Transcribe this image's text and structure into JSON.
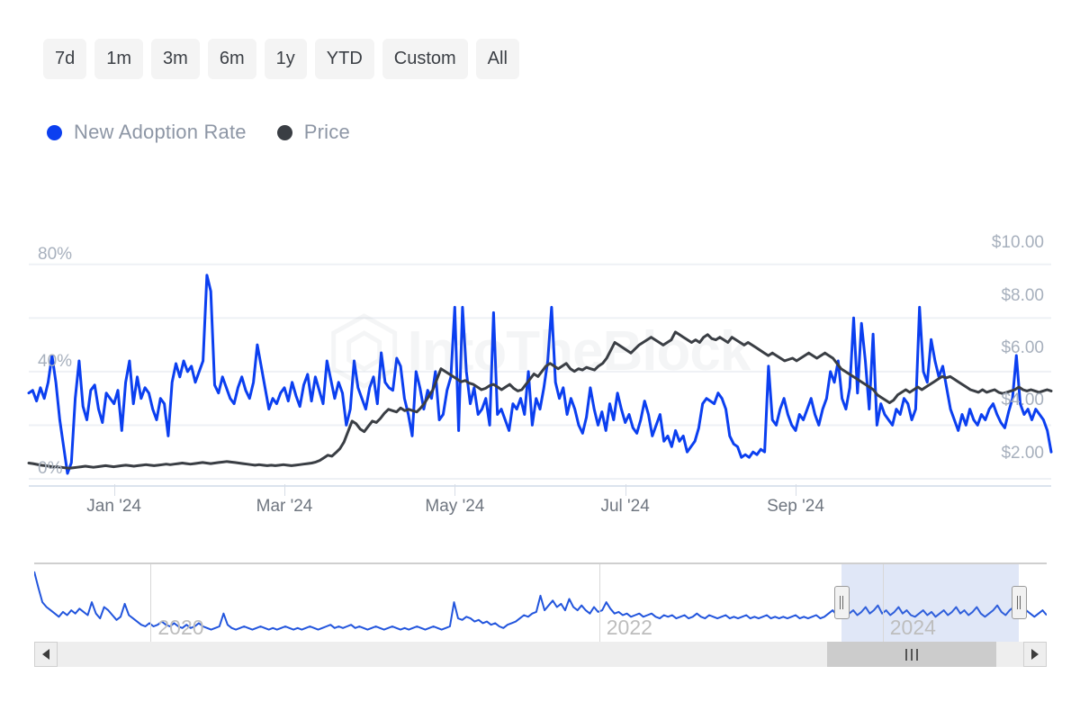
{
  "toolbar": {
    "ranges": [
      {
        "label": "7d",
        "active": false
      },
      {
        "label": "1m",
        "active": false
      },
      {
        "label": "3m",
        "active": false
      },
      {
        "label": "6m",
        "active": false
      },
      {
        "label": "1y",
        "active": false
      },
      {
        "label": "YTD",
        "active": false
      },
      {
        "label": "Custom",
        "active": false
      },
      {
        "label": "All",
        "active": false
      }
    ]
  },
  "legend": [
    {
      "label": "New Adoption Rate",
      "color": "#0b3ff0"
    },
    {
      "label": "Price",
      "color": "#3a3e44"
    }
  ],
  "watermark": {
    "text": "IntoTheBlock",
    "logo": "hexagon-logo-icon"
  },
  "navigator": {
    "years": [
      "2020",
      "2022",
      "2024"
    ],
    "selection_start_label": "left-handle",
    "selection_end_label": "right-handle",
    "scroll_left_label": "scroll-left",
    "scroll_right_label": "scroll-right"
  },
  "colors": {
    "adoption": "#0b3ff0",
    "price": "#3a3e44",
    "grid": "#eef1f5",
    "axis_text": "#a7b0bd",
    "xaxis_text": "#6f7680",
    "nav_select": "rgba(100,135,215,0.20)"
  },
  "chart_data": {
    "type": "line",
    "title": "",
    "xlabel": "",
    "grid": true,
    "legend_position": "top-left",
    "x_tick_labels": [
      "Jan '24",
      "Mar '24",
      "May '24",
      "Jul '24",
      "Sep '24"
    ],
    "x_tick_positions": [
      0.0833,
      0.25,
      0.4167,
      0.5833,
      0.75
    ],
    "axes": {
      "left": {
        "label": "New Adoption Rate",
        "ylabel": "%",
        "ticks": [
          "0%",
          "40%",
          "80%"
        ],
        "tick_values": [
          0,
          40,
          80
        ],
        "ylim": [
          0,
          90
        ],
        "gridline_values": [
          0,
          20,
          40,
          60,
          80
        ]
      },
      "right": {
        "label": "Price",
        "ylabel": "USD",
        "ticks": [
          "$2.00",
          "$4.00",
          "$6.00",
          "$8.00",
          "$10.00"
        ],
        "tick_values": [
          2,
          4,
          6,
          8,
          10
        ],
        "ylim": [
          1.4,
          10.6
        ]
      }
    },
    "series": [
      {
        "name": "New Adoption Rate",
        "color": "#0b3ff0",
        "axis": "left",
        "unit": "%",
        "values": [
          32,
          33,
          29,
          34,
          30,
          36,
          46,
          36,
          22,
          12,
          2,
          6,
          30,
          44,
          27,
          22,
          33,
          35,
          26,
          21,
          32,
          30,
          28,
          33,
          18,
          36,
          44,
          28,
          38,
          30,
          34,
          32,
          26,
          22,
          30,
          28,
          16,
          36,
          43,
          38,
          44,
          40,
          42,
          36,
          40,
          44,
          76,
          70,
          35,
          32,
          38,
          34,
          30,
          28,
          34,
          38,
          33,
          30,
          36,
          50,
          42,
          34,
          26,
          30,
          28,
          32,
          34,
          29,
          36,
          31,
          27,
          35,
          39,
          29,
          38,
          33,
          28,
          44,
          37,
          30,
          36,
          32,
          20,
          26,
          44,
          34,
          30,
          26,
          34,
          38,
          28,
          47,
          36,
          34,
          33,
          45,
          42,
          30,
          24,
          16,
          40,
          34,
          26,
          33,
          30,
          40,
          22,
          24,
          33,
          38,
          64,
          18,
          64,
          40,
          28,
          34,
          24,
          26,
          30,
          20,
          62,
          24,
          26,
          22,
          18,
          28,
          26,
          30,
          24,
          40,
          20,
          30,
          26,
          34,
          44,
          64,
          36,
          30,
          34,
          24,
          30,
          26,
          20,
          17,
          23,
          34,
          26,
          20,
          25,
          18,
          28,
          22,
          32,
          26,
          21,
          24,
          19,
          17,
          22,
          29,
          24,
          16,
          20,
          24,
          14,
          16,
          12,
          18,
          14,
          16,
          10,
          12,
          14,
          19,
          28,
          30,
          29,
          28,
          32,
          30,
          26,
          16,
          13,
          12,
          8,
          9,
          8,
          10,
          9,
          11,
          10,
          42,
          22,
          20,
          26,
          30,
          24,
          20,
          18,
          24,
          22,
          26,
          30,
          24,
          20,
          26,
          30,
          40,
          36,
          44,
          30,
          26,
          34,
          60,
          32,
          58,
          44,
          26,
          54,
          20,
          28,
          24,
          22,
          20,
          26,
          24,
          30,
          28,
          22,
          26,
          64,
          40,
          36,
          52,
          44,
          38,
          42,
          34,
          26,
          22,
          18,
          24,
          20,
          26,
          22,
          20,
          24,
          22,
          26,
          28,
          24,
          21,
          19,
          25,
          30,
          46,
          28,
          24,
          26,
          22,
          26,
          24,
          22,
          18,
          10
        ]
      },
      {
        "name": "Price",
        "color": "#3a3e44",
        "axis": "right",
        "unit": "USD",
        "values": [
          2.0,
          1.98,
          1.95,
          1.92,
          1.9,
          1.88,
          1.85,
          1.86,
          1.84,
          1.82,
          1.8,
          1.82,
          1.84,
          1.86,
          1.88,
          1.86,
          1.84,
          1.86,
          1.88,
          1.9,
          1.88,
          1.86,
          1.88,
          1.9,
          1.92,
          1.9,
          1.88,
          1.9,
          1.92,
          1.94,
          1.92,
          1.9,
          1.92,
          1.94,
          1.96,
          1.94,
          1.96,
          1.98,
          2.0,
          1.98,
          1.96,
          1.98,
          2.0,
          2.02,
          2.0,
          1.98,
          2.0,
          2.02,
          2.04,
          2.06,
          2.04,
          2.02,
          2.0,
          1.98,
          1.96,
          1.94,
          1.92,
          1.94,
          1.92,
          1.9,
          1.92,
          1.9,
          1.92,
          1.94,
          1.92,
          1.9,
          1.92,
          1.94,
          1.96,
          1.98,
          2.0,
          2.04,
          2.1,
          2.2,
          2.3,
          2.26,
          2.4,
          2.55,
          2.8,
          3.2,
          3.6,
          3.5,
          3.3,
          3.2,
          3.4,
          3.6,
          3.55,
          3.7,
          3.9,
          4.05,
          4.0,
          3.95,
          4.1,
          4.0,
          4.05,
          4.0,
          3.95,
          4.1,
          4.3,
          4.55,
          4.8,
          5.2,
          5.6,
          5.5,
          5.4,
          5.3,
          5.2,
          5.1,
          5.15,
          5.05,
          5.0,
          4.9,
          4.8,
          4.85,
          4.95,
          5.0,
          4.9,
          4.8,
          4.9,
          5.0,
          4.85,
          4.75,
          4.8,
          5.0,
          5.2,
          5.4,
          5.3,
          5.5,
          5.7,
          5.8,
          5.7,
          5.6,
          5.7,
          5.8,
          5.6,
          5.5,
          5.6,
          5.55,
          5.65,
          5.6,
          5.55,
          5.7,
          5.8,
          6.0,
          6.3,
          6.6,
          6.5,
          6.4,
          6.3,
          6.2,
          6.35,
          6.5,
          6.6,
          6.7,
          6.8,
          6.7,
          6.6,
          6.5,
          6.6,
          6.7,
          7.0,
          6.9,
          6.8,
          6.7,
          6.6,
          6.7,
          6.6,
          6.8,
          6.9,
          6.75,
          6.7,
          6.8,
          6.7,
          6.6,
          6.8,
          6.7,
          6.6,
          6.5,
          6.6,
          6.5,
          6.4,
          6.3,
          6.2,
          6.1,
          6.2,
          6.1,
          6.0,
          5.9,
          5.95,
          6.0,
          5.9,
          6.0,
          6.1,
          6.2,
          6.1,
          6.0,
          6.1,
          6.2,
          6.1,
          6.0,
          5.8,
          5.6,
          5.5,
          5.4,
          5.3,
          5.2,
          5.1,
          5.0,
          4.9,
          4.8,
          4.6,
          4.5,
          4.4,
          4.3,
          4.4,
          4.6,
          4.7,
          4.8,
          4.7,
          4.8,
          4.9,
          4.8,
          4.9,
          5.0,
          5.1,
          5.2,
          5.3,
          5.25,
          5.3,
          5.2,
          5.1,
          5.0,
          4.9,
          4.8,
          4.75,
          4.7,
          4.8,
          4.7,
          4.75,
          4.8,
          4.7,
          4.65,
          4.7,
          4.75,
          4.8,
          4.9,
          4.8,
          4.75,
          4.8,
          4.75,
          4.7,
          4.75,
          4.8,
          4.75
        ]
      }
    ],
    "navigator_series": {
      "name": "New Adoption Rate (full history)",
      "color": "#2255dd",
      "values": [
        78,
        58,
        40,
        34,
        30,
        26,
        22,
        28,
        24,
        30,
        26,
        32,
        28,
        24,
        40,
        26,
        20,
        34,
        30,
        24,
        18,
        22,
        38,
        24,
        20,
        16,
        12,
        10,
        14,
        10,
        12,
        16,
        12,
        10,
        14,
        10,
        8,
        12,
        8,
        10,
        14,
        10,
        8,
        6,
        8,
        10,
        26,
        12,
        8,
        6,
        8,
        10,
        8,
        6,
        8,
        10,
        8,
        6,
        8,
        6,
        8,
        10,
        8,
        6,
        8,
        6,
        8,
        10,
        8,
        6,
        8,
        10,
        12,
        8,
        10,
        8,
        10,
        12,
        8,
        10,
        8,
        6,
        8,
        10,
        8,
        6,
        8,
        10,
        8,
        6,
        8,
        6,
        8,
        10,
        8,
        6,
        8,
        10,
        8,
        6,
        8,
        10,
        40,
        20,
        18,
        22,
        20,
        16,
        18,
        14,
        16,
        12,
        14,
        10,
        8,
        12,
        14,
        16,
        20,
        24,
        22,
        26,
        28,
        48,
        30,
        36,
        42,
        34,
        38,
        30,
        44,
        34,
        30,
        36,
        30,
        26,
        34,
        28,
        30,
        40,
        32,
        26,
        28,
        24,
        26,
        22,
        24,
        26,
        22,
        24,
        26,
        22,
        20,
        24,
        22,
        24,
        20,
        22,
        24,
        20,
        22,
        26,
        22,
        20,
        24,
        22,
        20,
        22,
        24,
        20,
        22,
        20,
        22,
        24,
        20,
        22,
        20,
        22,
        24,
        20,
        22,
        20,
        22,
        20,
        22,
        24,
        20,
        22,
        20,
        22,
        24,
        20,
        22,
        26,
        30,
        24,
        28,
        34,
        26,
        30,
        24,
        28,
        34,
        26,
        30,
        36,
        26,
        30,
        24,
        28,
        34,
        26,
        30,
        24,
        22,
        26,
        30,
        24,
        28,
        22,
        26,
        30,
        24,
        28,
        34,
        26,
        30,
        24,
        28,
        34,
        26,
        22,
        26,
        30,
        36,
        28,
        24,
        30,
        34,
        28,
        24,
        30,
        26,
        22,
        26,
        30,
        24
      ]
    },
    "navigator_selection": {
      "start_fraction": 0.797,
      "end_fraction": 0.972
    }
  }
}
